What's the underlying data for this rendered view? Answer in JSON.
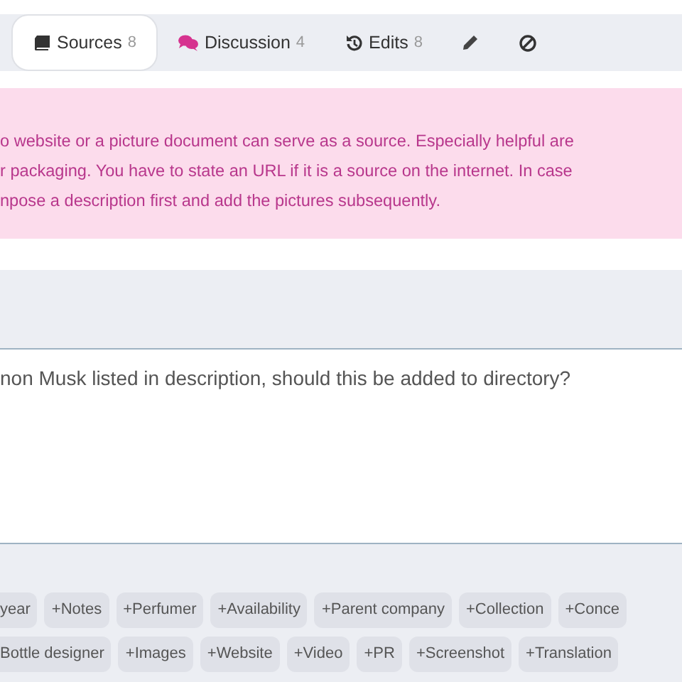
{
  "tabs": [
    {
      "kind": "book",
      "label": "Sources",
      "count": "8",
      "selected": true
    },
    {
      "kind": "chat",
      "label": "Discussion",
      "count": "4",
      "selected": false
    },
    {
      "kind": "history",
      "label": "Edits",
      "count": "8",
      "selected": false
    },
    {
      "kind": "pencil",
      "selected": false
    },
    {
      "kind": "ban",
      "selected": false
    }
  ],
  "alert": {
    "lines": [
      "o website or a picture document can serve as a source. Especially helpful are",
      "r packaging. You have to state an URL if it is a source on the internet. In case",
      "npose a description first and add the pictures subsequently."
    ]
  },
  "comment_field": {
    "value": "non Musk listed in description, should this be added to directory?"
  },
  "tag_rows": [
    [
      "year",
      "+Notes",
      "+Perfumer",
      "+Availability",
      "+Parent company",
      "+Collection",
      "+Conce"
    ],
    [
      "Bottle designer",
      "+Images",
      "+Website",
      "+Video",
      "+PR",
      "+Screenshot",
      "+Translation"
    ]
  ]
}
